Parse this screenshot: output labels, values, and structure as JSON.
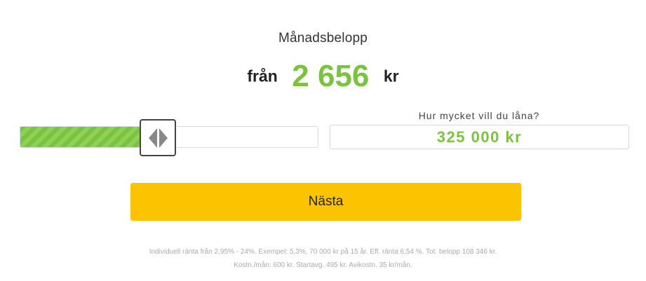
{
  "header": {
    "title": "Månadsbelopp"
  },
  "monthly": {
    "prefix": "från",
    "amount": "2 656",
    "currency": "kr"
  },
  "slider": {
    "level_percent": 46,
    "fill_color": "#7cc242"
  },
  "loan": {
    "label": "Hur mycket vill du låna?",
    "value": "325 000 kr"
  },
  "actions": {
    "next_label": "Nästa",
    "button_color": "#fcc400"
  },
  "disclaimer": {
    "line1": "Individuell ränta från 2,95% - 24%. Exempel: 5,3%, 70 000 kr på 15 år. Eff. ränta 6,54 %. Tot. belopp 108 346 kr.",
    "line2": "Kostn./mån: 600 kr. Startavg. 495 kr. Avikostn. 35 kr/mån."
  },
  "icons": {
    "slider_handle": "left-right-arrows-icon"
  }
}
